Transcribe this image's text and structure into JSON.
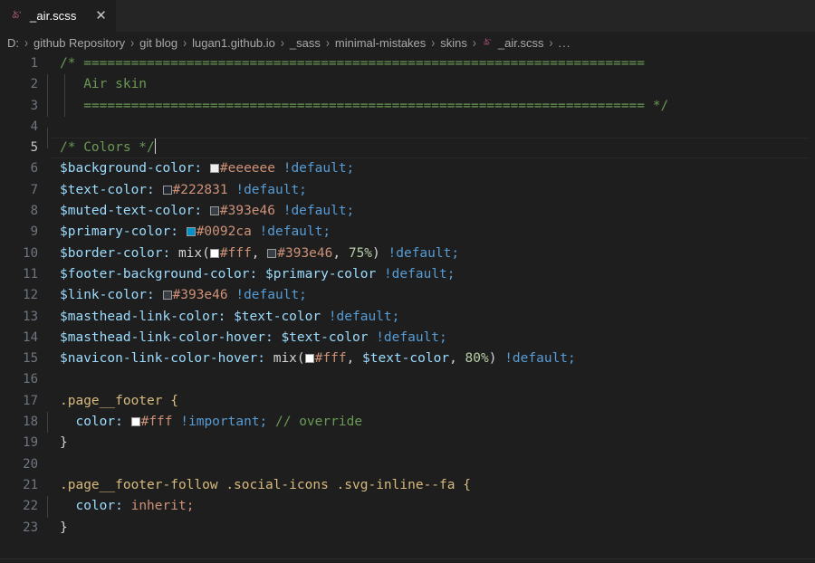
{
  "window": {
    "theme_bg": "#1e1e1e",
    "tabbar_bg": "#252526"
  },
  "tab": {
    "label": "_air.scss",
    "icon": "sass-icon",
    "icon_color": "#CF649A",
    "close_label": "✕"
  },
  "breadcrumb": {
    "separator": "›",
    "items": [
      "D:",
      "github Repository",
      "git blog",
      "lugan1.github.io",
      "_sass",
      "minimal-mistakes",
      "skins"
    ],
    "file": "_air.scss",
    "file_icon": "sass-icon",
    "more": "..."
  },
  "editor": {
    "language": "scss",
    "active_line": 5,
    "first_line": 1,
    "last_line": 23,
    "line_numbers": [
      1,
      2,
      3,
      4,
      5,
      6,
      7,
      8,
      9,
      10,
      11,
      12,
      13,
      14,
      15,
      16,
      17,
      18,
      19,
      20,
      21,
      22,
      23
    ],
    "equals_rule": "=======================================================================",
    "lines": {
      "l1_comment_open": "/*",
      "l2_title": "Air skin",
      "l3_comment_close": "*/",
      "l5_colors_comment": "/* Colors */",
      "l6_name": "$background-color:",
      "l6_hex": "#eeeeee",
      "l6_swatch": "#eeeeee",
      "l7_name": "$text-color:",
      "l7_hex": "#222831",
      "l7_swatch": "#222831",
      "l8_name": "$muted-text-color:",
      "l8_hex": "#393e46",
      "l8_swatch": "#393e46",
      "l9_name": "$primary-color:",
      "l9_hex": "#0092ca",
      "l9_swatch": "#0092ca",
      "l10_name": "$border-color:",
      "l10_func": "mix(",
      "l10_hex_a": "#fff",
      "l10_swatch_a": "#ffffff",
      "l10_hex_b": "#393e46",
      "l10_swatch_b": "#393e46",
      "l10_pct": "75%",
      "l10_close": ")",
      "l11_name": "$footer-background-color:",
      "l11_ref": "$primary-color",
      "l12_name": "$link-color:",
      "l12_hex": "#393e46",
      "l12_swatch": "#393e46",
      "l13_name": "$masthead-link-color:",
      "l13_ref": "$text-color",
      "l14_name": "$masthead-link-color-hover:",
      "l14_ref": "$text-color",
      "l15_name": "$navicon-link-color-hover:",
      "l15_func": "mix(",
      "l15_hex": "#fff",
      "l15_swatch": "#ffffff",
      "l15_ref": "$text-color",
      "l15_pct": "80%",
      "l15_close": ")",
      "l17_selector": ".page__footer {",
      "l18_prop": "color:",
      "l18_hex": "#fff",
      "l18_swatch": "#ffffff",
      "l18_important": "!important;",
      "l18_comment": "// override",
      "l19_brace": "}",
      "l21_selector": ".page__footer-follow .social-icons .svg-inline--fa {",
      "l22_prop": "color:",
      "l22_value": "inherit;",
      "l23_brace": "}",
      "default_flag": "!default;",
      "comma": ",",
      "semicolon": ";"
    }
  }
}
